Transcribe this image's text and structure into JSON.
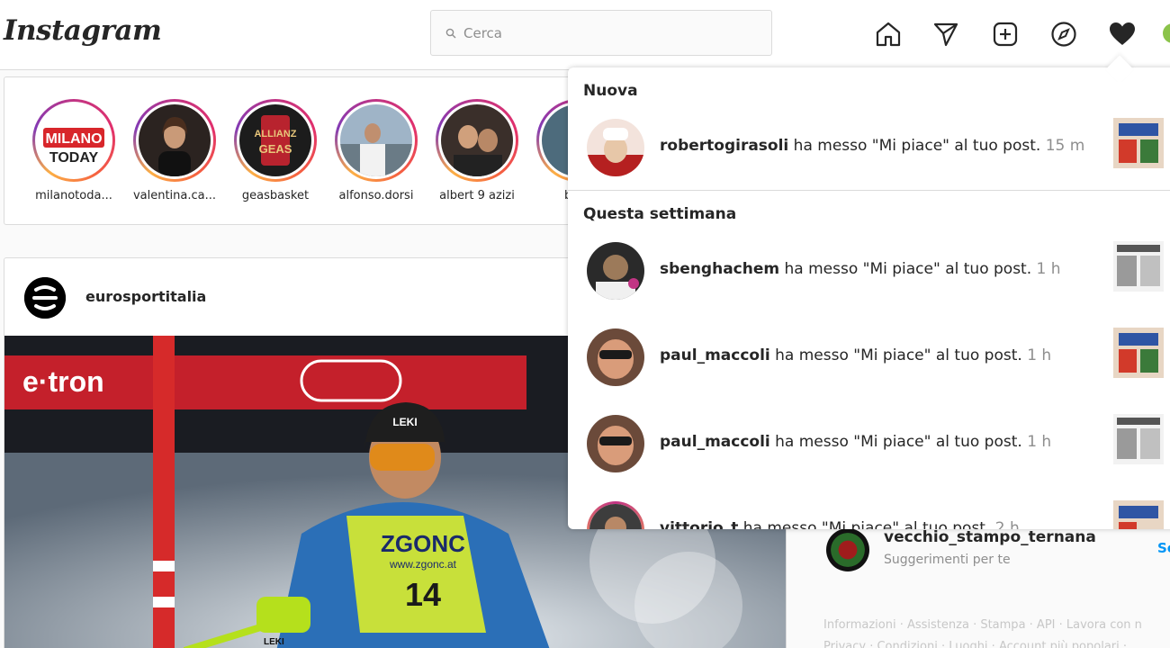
{
  "header": {
    "logo": "Instagram",
    "search_placeholder": "Cerca"
  },
  "nav_icons": [
    "home-icon",
    "direct-icon",
    "new-post-icon",
    "explore-icon",
    "activity-heart-icon"
  ],
  "stories": [
    {
      "username": "milanotoda...",
      "avatar_label": "MILANO TODAY"
    },
    {
      "username": "valentina.ca..."
    },
    {
      "username": "geasbasket",
      "avatar_label": "ALLIANZ GEAS"
    },
    {
      "username": "alfonso.dorsi"
    },
    {
      "username": "albert 9 azizi"
    },
    {
      "username": "betti"
    }
  ],
  "post": {
    "username": "eurosportitalia",
    "image_text": {
      "bib_sponsor": "ZGONC",
      "bib_url": "www.zgonc.at",
      "bib_number": "14",
      "helmet_brand": "LEKI"
    }
  },
  "sidebar": {
    "suggestion": {
      "username": "vecchio_stampo_ternana",
      "subtitle": "Suggerimenti per te",
      "follow_label": "Se"
    },
    "footer_line1": "Informazioni · Assistenza · Stampa · API · Lavora con n",
    "footer_line2": "Privacy · Condizioni · Luoghi · Account più popolari ·"
  },
  "activity": {
    "section_new": "Nuova",
    "section_week": "Questa settimana",
    "new_items": [
      {
        "user": "robertogirasoli",
        "action": "ha messo \"Mi piace\" al tuo post.",
        "time": "15 m"
      }
    ],
    "week_items": [
      {
        "user": "sbenghachem",
        "action": "ha messo \"Mi piace\" al tuo post.",
        "time": "1 h"
      },
      {
        "user": "paul_maccoli",
        "action": "ha messo \"Mi piace\" al tuo post.",
        "time": "1 h"
      },
      {
        "user": "paul_maccoli",
        "action": "ha messo \"Mi piace\" al tuo post.",
        "time": "1 h"
      },
      {
        "user": "vittorio_t",
        "action": "ha messo \"Mi piace\" al tuo post.",
        "time": "2 h"
      }
    ]
  },
  "colors": {
    "accent": "#0095f6",
    "border": "#dbdbdb",
    "muted": "#8e8e8e"
  }
}
